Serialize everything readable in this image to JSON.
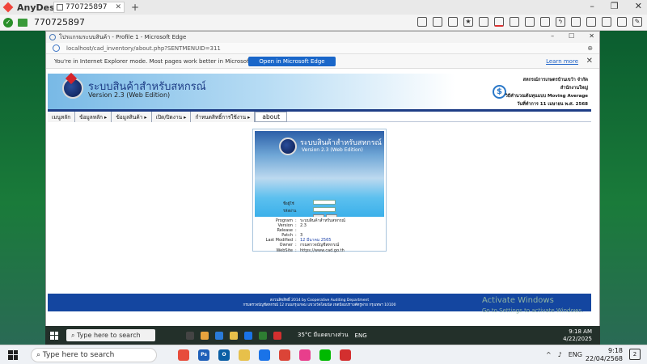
{
  "anydesk": {
    "app_name": "AnyDesk",
    "tab_label": "770725897",
    "address_id": "770725897",
    "tools": [
      "chat-icon",
      "hourglass-icon",
      "database-icon",
      "star-icon",
      "file-icon",
      "monitor-icon",
      "display-icon",
      "message-icon",
      "list-icon",
      "lightning-icon",
      "keyboard-icon",
      "actions-icon",
      "record-icon",
      "disconnect-icon",
      "draw-icon"
    ]
  },
  "edge": {
    "window_title": "โปรแกรมระบบสินค้า - Profile 1 - Microsoft Edge",
    "url": "localhost/cad_inventory/about.php?SENTMENUID=311",
    "ie_notice": "You're in Internet Explorer mode. Most pages work better in Microsoft Edge.",
    "ie_button": "Open in Microsoft Edge",
    "ie_learn": "Learn more"
  },
  "banner": {
    "title": "ระบบสินค้าสำหรับสหกรณ์",
    "version": "Version 2.3 (Web Edition)",
    "coop_lines": [
      "สหกรณ์การเกษตรบ้านเขว้า จำกัด",
      "สำนักงานใหญ่",
      "วิธีคำนวณต้นทุนแบบ Moving Average",
      "วันที่ทำการ 11 เมษายน พ.ศ. 2568"
    ]
  },
  "menu": {
    "items": [
      "เมนูหลัก",
      "ข้อมูลหลัก ▸",
      "ข้อมูลสินค้า ▸",
      "เปิด/ปิดงาน ▸",
      "กำหนดสิทธิ์การใช้งาน ▸"
    ],
    "about": "about"
  },
  "login": {
    "title": "ระบบสินค้าสำหรับสหกรณ์",
    "version": "Version 2.3 (Web Edition)",
    "user_label": "ชื่อผู้ใช้",
    "pass_label": "รหัสผ่าน"
  },
  "about_info": [
    {
      "k": "Program",
      "v": "ระบบสินค้าสำหรับสหกรณ์"
    },
    {
      "k": "Version",
      "v": "2.3"
    },
    {
      "k": "Release",
      "v": ""
    },
    {
      "k": "Patch",
      "v": "3"
    },
    {
      "k": "Last Modified",
      "v": "12 มีนาคม 2565"
    },
    {
      "k": "Owner",
      "v": "กรมตรวจบัญชีสหกรณ์"
    },
    {
      "k": "WebSite",
      "v": "https://www.cad.go.th"
    }
  ],
  "footer": {
    "line1": "สงวนลิขสิทธิ์ 2014 by Cooperative Auditing Department",
    "line2": "กรมตรวจบัญชีสหกรณ์ 12 ถนนกรุงเกษม แขวงวัดโสมนัส เขตป้อมปราบศัตรูพ่าย กรุงเทพฯ 10100"
  },
  "activate": {
    "title": "Activate Windows",
    "sub": "Go to Settings to activate Windows."
  },
  "remote_taskbar": {
    "search": "Type here to search",
    "weather": "35°C มีแดดบางส่วน",
    "lang": "ENG",
    "time": "9:18 AM",
    "date": "4/22/2025"
  },
  "taskbar": {
    "search": "Type here to search",
    "lang": "ENG",
    "time": "9:18",
    "date": "22/04/2568",
    "notify_count": "2",
    "app_colors": [
      "#e74c3c",
      "#1e5fb8",
      "#e67e22",
      "#0b5fa5",
      "#2e7d32",
      "#1a73e8",
      "#db4437",
      "#e83e8c",
      "#00b900",
      "#d32f2f"
    ]
  }
}
